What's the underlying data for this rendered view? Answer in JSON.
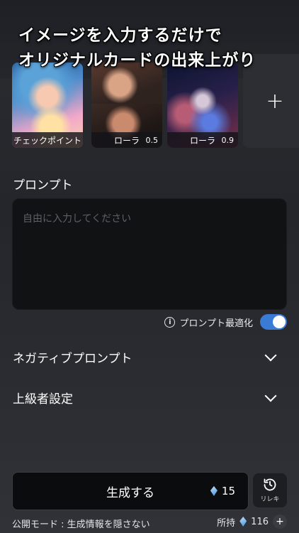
{
  "banner": {
    "line1": "イメージを入力するだけで",
    "line2": "オリジナルカードの出来上がり"
  },
  "models": [
    {
      "caption": "チェックポイント",
      "weight": ""
    },
    {
      "caption": "ローラ",
      "weight": "0.5"
    },
    {
      "caption": "ローラ",
      "weight": "0.9"
    }
  ],
  "add_model_symbol": "+",
  "prompt": {
    "label": "プロンプト",
    "placeholder": "自由に入力してください",
    "value": ""
  },
  "optimize": {
    "label": "プロンプト最適化",
    "enabled": true,
    "toggle_color": "#3a7bd5"
  },
  "negative_prompt": {
    "label": "ネガティブプロンプト"
  },
  "advanced": {
    "label": "上級者設定"
  },
  "generate": {
    "label": "生成する",
    "cost": "15"
  },
  "history": {
    "label": "リレキ"
  },
  "footer": {
    "mode": "公開モード : 生成情報を隠さない",
    "own_label": "所持",
    "own_value": "116",
    "plus": "+"
  }
}
